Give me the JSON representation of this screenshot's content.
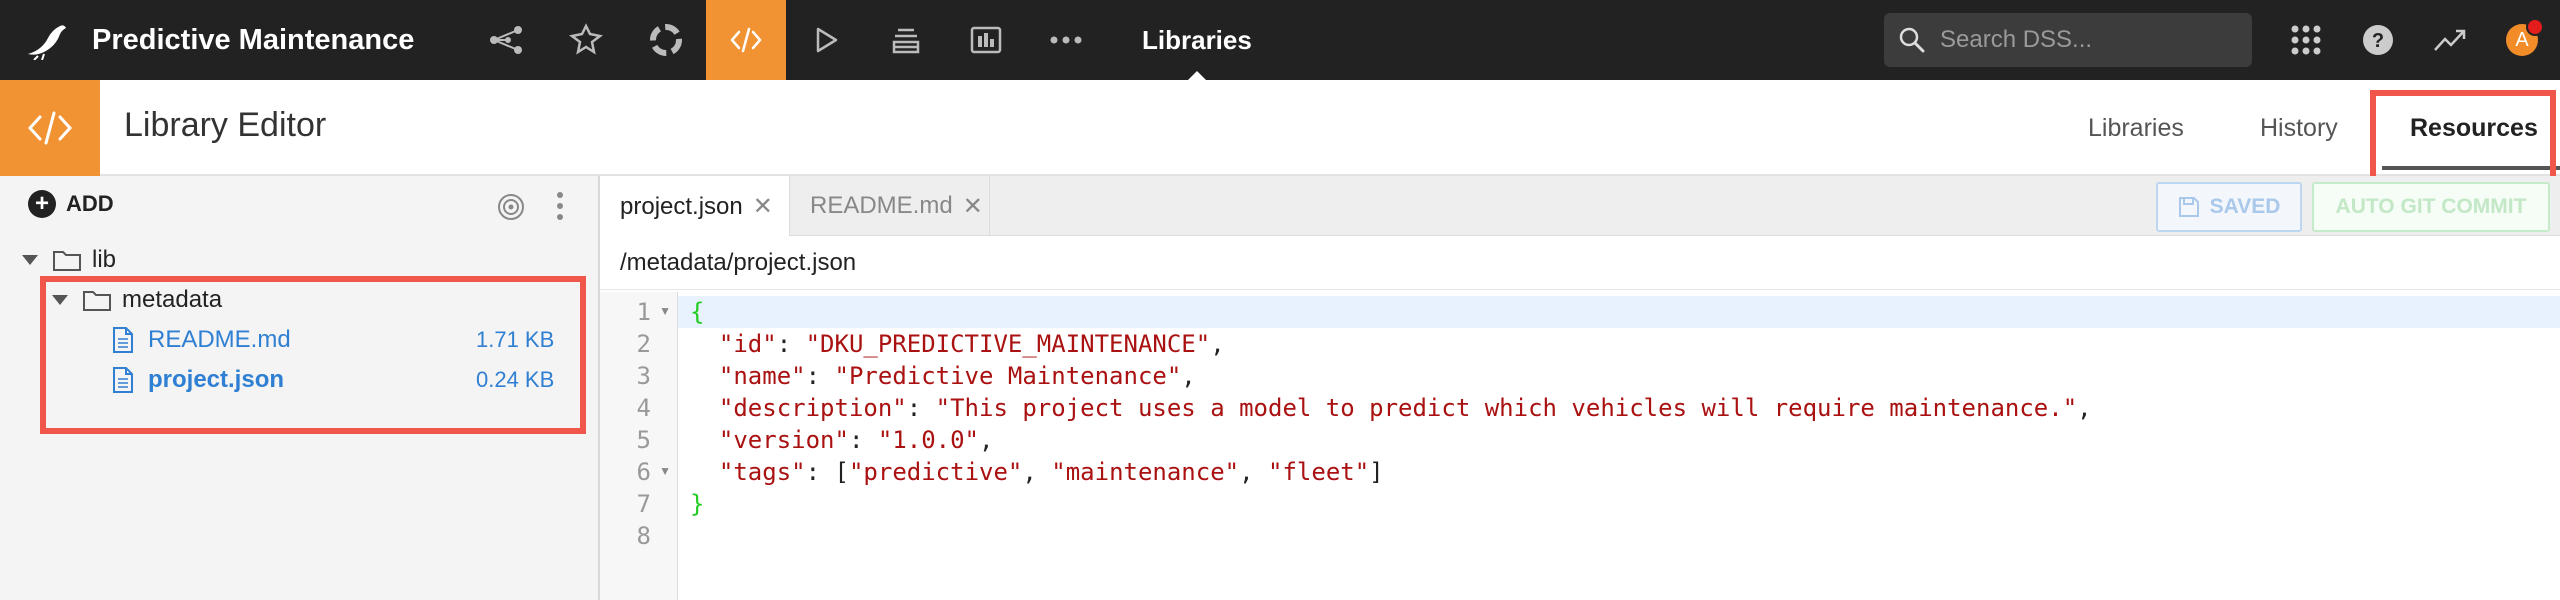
{
  "topbar": {
    "project_title": "Predictive Maintenance",
    "section_label": "Libraries",
    "search_placeholder": "Search DSS...",
    "avatar_letter": "A",
    "nav_icons": [
      "flow-icon",
      "lab-icon",
      "recipes-icon",
      "code-icon",
      "run-icon",
      "datasets-icon",
      "dashboard-icon",
      "more-icon"
    ]
  },
  "subbar": {
    "title": "Library Editor",
    "tabs": [
      "Libraries",
      "History",
      "Resources"
    ],
    "active_tab": "Resources"
  },
  "left_panel": {
    "add_label": "ADD",
    "tree": {
      "root": "lib",
      "folder": "metadata",
      "files": [
        {
          "name": "README.md",
          "size": "1.71 KB"
        },
        {
          "name": "project.json",
          "size": "0.24 KB"
        }
      ]
    }
  },
  "editor": {
    "tabs": [
      {
        "label": "project.json",
        "active": true
      },
      {
        "label": "README.md",
        "active": false
      }
    ],
    "saved_label": "SAVED",
    "commit_label": "AUTO GIT COMMIT",
    "path": "/metadata/project.json",
    "line_numbers": [
      "1",
      "2",
      "3",
      "4",
      "5",
      "6",
      "7",
      "8"
    ],
    "code": {
      "open": "{",
      "id_key": "\"id\"",
      "id_val": "\"DKU_PREDICTIVE_MAINTENANCE\"",
      "name_key": "\"name\"",
      "name_val": "\"Predictive Maintenance\"",
      "desc_key": "\"description\"",
      "desc_val": "\"This project uses a model to predict which vehicles will require maintenance.\"",
      "version_key": "\"version\"",
      "version_val": "\"1.0.0\"",
      "tags_key": "\"tags\"",
      "tag1": "\"predictive\"",
      "tag2": "\"maintenance\"",
      "tag3": "\"fleet\"",
      "close": "}"
    }
  },
  "colors": {
    "accent": "#f29333",
    "topbar": "#222222",
    "highlight": "#f0564a",
    "link": "#2f7fd3"
  }
}
